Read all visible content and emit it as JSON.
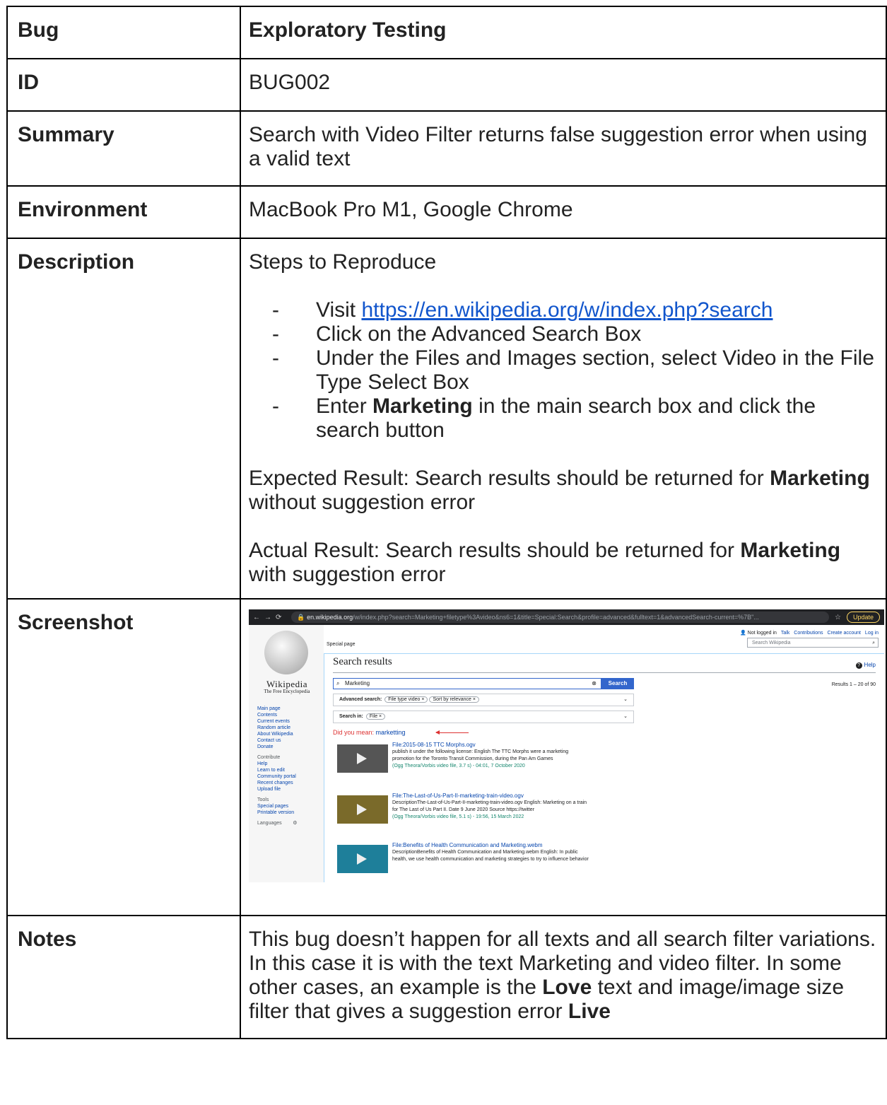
{
  "rows": {
    "bug": {
      "label": "Bug",
      "value": "Exploratory Testing"
    },
    "id": {
      "label": "ID",
      "value": "BUG002"
    },
    "summary": {
      "label": "Summary",
      "value": "Search with Video Filter returns false suggestion error when using a valid text"
    },
    "environment": {
      "label": "Environment",
      "value": "MacBook Pro M1, Google Chrome"
    },
    "description": {
      "label": "Description",
      "heading": "Steps to Reproduce",
      "steps": [
        {
          "pre": "Visit ",
          "link": "https://en.wikipedia.org/w/index.php?search"
        },
        {
          "text": "Click on the Advanced Search Box"
        },
        {
          "text": "Under the Files and Images section, select Video in the File Type Select Box"
        },
        {
          "pre": "Enter ",
          "bold": "Marketing",
          "post": " in the main search box and click the search button"
        }
      ],
      "expected": {
        "pre": "Expected Result: Search results should be returned for ",
        "bold": "Marketing",
        "post": " without suggestion error"
      },
      "actual": {
        "pre": "Actual Result: Search results should be returned for ",
        "bold": "Marketing",
        "post": " with suggestion error"
      }
    },
    "screenshot": {
      "label": "Screenshot"
    },
    "notes": {
      "label": "Notes",
      "pre": "This bug doesn’t happen for all texts and all search filter variations. In this case it is with the text Marketing and video filter. In some other cases, an example is the ",
      "bold1": "Love",
      "mid": " text and image/image size filter that gives a suggestion error ",
      "bold2": "Live"
    }
  },
  "shot": {
    "url_domain": "en.wikipedia.org",
    "url_rest": "/w/index.php?search=Marketing+filetype%3Avideo&ns6=1&title=Special:Search&profile=advanced&fulltext=1&advancedSearch-current=%7B\"...",
    "update_label": "Update",
    "logo_title": "Wikipedia",
    "logo_sub": "The Free Encyclopedia",
    "nav": [
      "Main page",
      "Contents",
      "Current events",
      "Random article",
      "About Wikipedia",
      "Contact us",
      "Donate"
    ],
    "contribute_heading": "Contribute",
    "contribute": [
      "Help",
      "Learn to edit",
      "Community portal",
      "Recent changes",
      "Upload file"
    ],
    "tools_heading": "Tools",
    "tools": [
      "Special pages",
      "Printable version"
    ],
    "languages": "Languages",
    "user": {
      "not_logged": "Not logged in",
      "talk": "Talk",
      "contributions": "Contributions",
      "create": "Create account",
      "login": "Log in"
    },
    "special_tab": "Special page",
    "search_placeholder": "Search Wikipedia",
    "title": "Search results",
    "help": "Help",
    "query": "Marketing",
    "search_button": "Search",
    "results_count": "Results 1 – 20 of 90",
    "advanced_label": "Advanced search:",
    "chip1": "File type video ×",
    "chip2": "Sort by relevance ×",
    "searchin_label": "Search in:",
    "chip3": "File ×",
    "dym_label": "Did you mean:",
    "dym_suggest": "marketting",
    "results": [
      {
        "title": "File:2015-08-15 TTC Morphs.ogv",
        "snippet": "publish it under the following license: English The TTC Morphs were a marketing promotion for the Toronto Transit Commission, during the Pan Am Games",
        "meta": "(Ogg Theora/Vorbis video file, 3.7 s) - 04:01, 7 October 2020"
      },
      {
        "title": "File:The-Last-of-Us-Part-II-marketing-train-video.ogv",
        "snippet": "DescriptionThe-Last-of-Us-Part-II-marketing-train-video.ogv English: Marketing on a train for The Last of Us Part II. Date 9 June 2020 Source https://twitter",
        "meta": "(Ogg Theora/Vorbis video file, 5.1 s) - 19:56, 15 March 2022"
      },
      {
        "title": "File:Benefits of Health Communication and Marketing.webm",
        "snippet": "DescriptionBenefits of Health Communication and Marketing.webm English: In public health, we use health communication and marketing strategies to try to influence behavior",
        "meta": ""
      }
    ]
  }
}
